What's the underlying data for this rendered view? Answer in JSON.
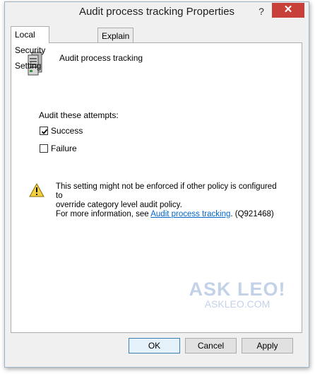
{
  "window": {
    "title": "Audit process tracking Properties",
    "help_label": "?",
    "close_label": "✕"
  },
  "tabs": [
    {
      "label": "Local Security Setting",
      "active": true
    },
    {
      "label": "Explain",
      "active": false
    }
  ],
  "policy": {
    "name": "Audit process tracking",
    "icon": "server-icon"
  },
  "audit": {
    "label": "Audit these attempts:",
    "options": [
      {
        "label": "Success",
        "checked": true
      },
      {
        "label": "Failure",
        "checked": false
      }
    ]
  },
  "warning": {
    "line1": "This setting might not be enforced if other policy is configured to",
    "line2": "override category level audit policy.",
    "line3_prefix": "For more information, see ",
    "link_text": "Audit process tracking",
    "line3_suffix": ". (Q921468)"
  },
  "watermark": {
    "big": "ASK LEO!",
    "small": "ASKLEO.COM"
  },
  "buttons": {
    "ok": "OK",
    "cancel": "Cancel",
    "apply": "Apply"
  },
  "colors": {
    "close_bg": "#c7403a",
    "link": "#0066cc",
    "watermark": "#c3d2e8"
  }
}
